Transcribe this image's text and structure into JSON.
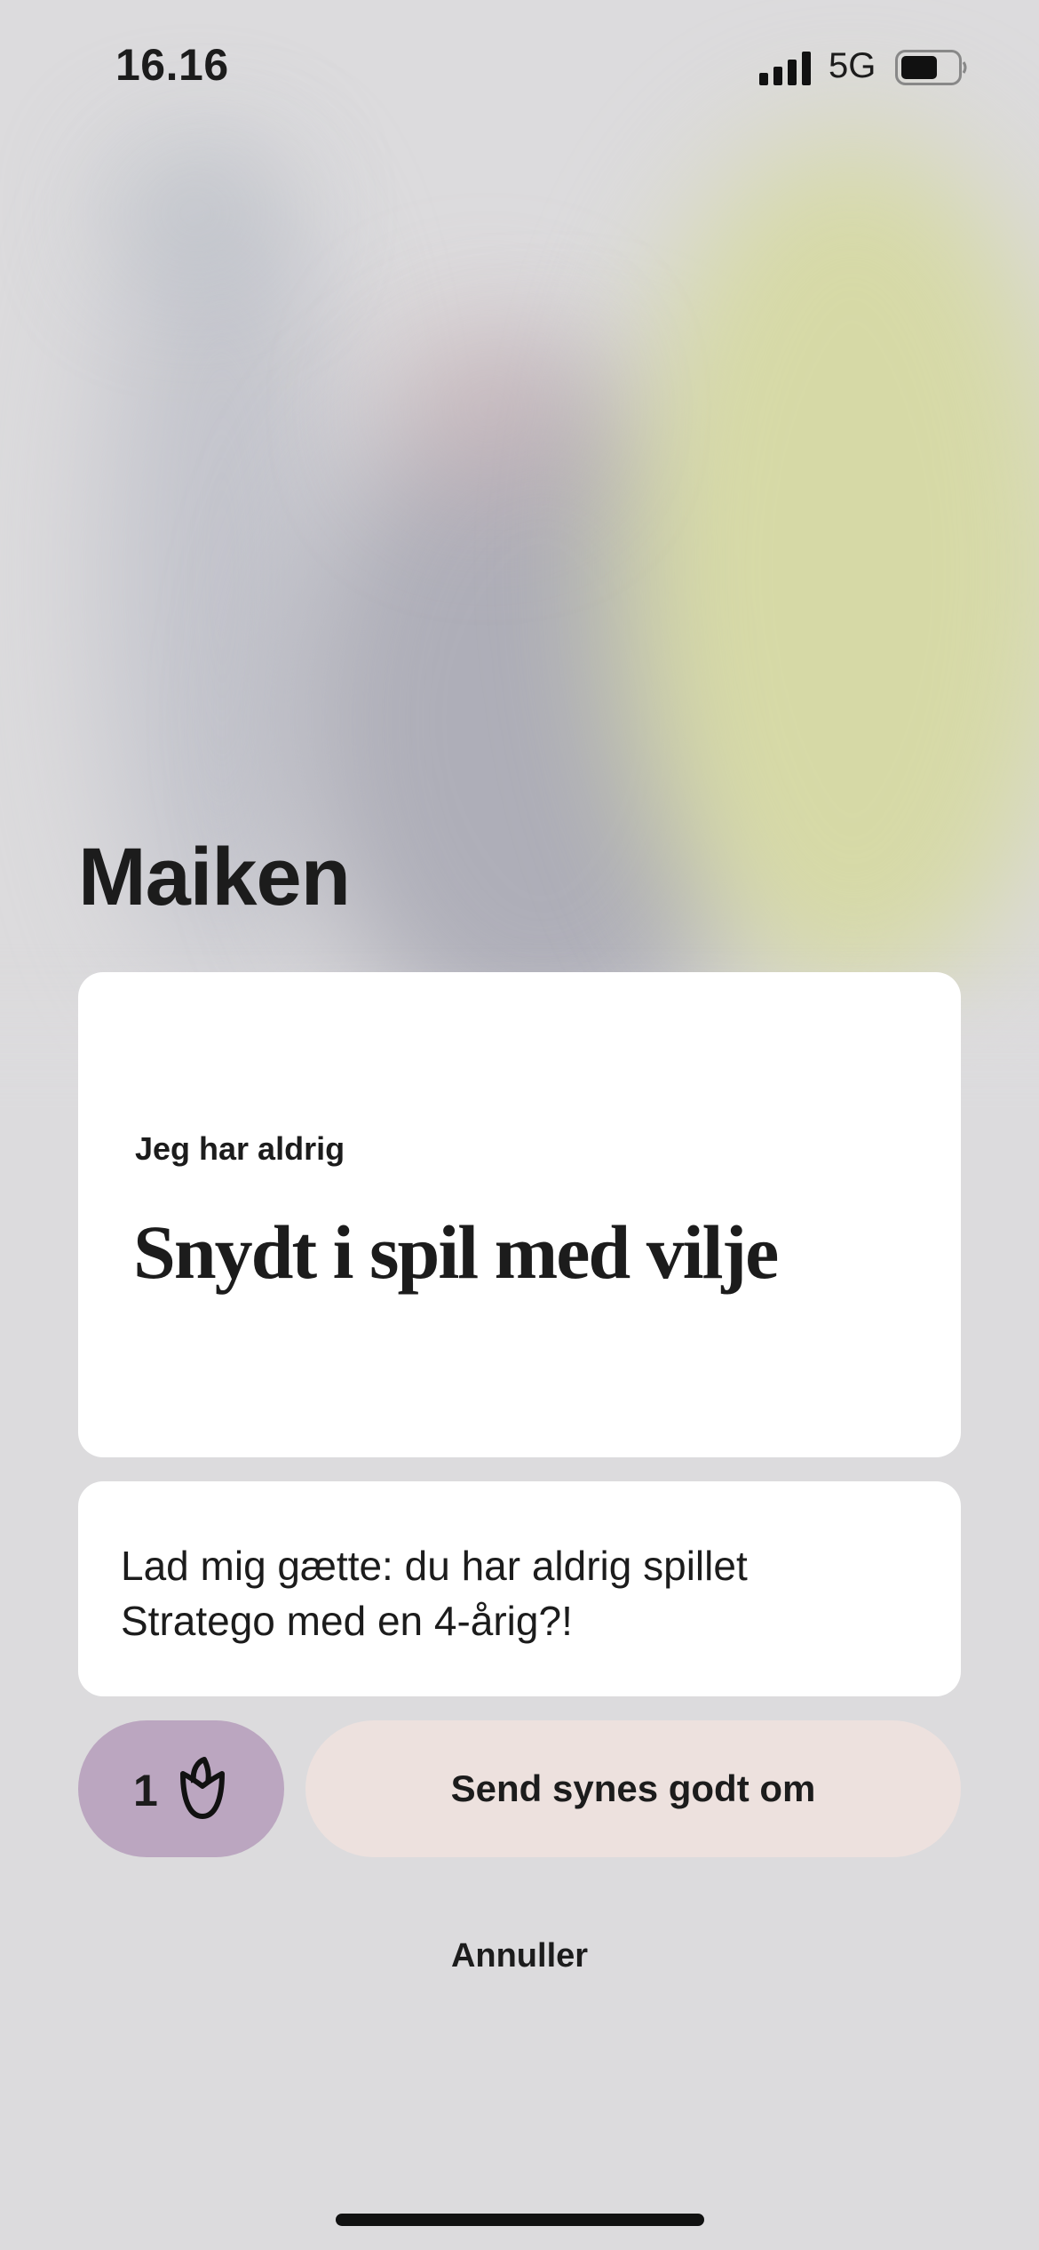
{
  "status_bar": {
    "time": "16.16",
    "network": "5G",
    "signal_icon": "cellular-signal-icon",
    "battery_icon": "battery-icon"
  },
  "profile": {
    "name": "Maiken"
  },
  "prompt": {
    "label": "Jeg har aldrig",
    "answer": "Snydt i spil med vilje"
  },
  "comment": {
    "text": "Lad mig gætte: du har aldrig spillet Stratego med en 4-årig?!"
  },
  "actions": {
    "rose_count": "1",
    "rose_icon": "rose-icon",
    "send_label": "Send synes godt om",
    "cancel_label": "Annuller"
  },
  "colors": {
    "rose_button": "#bba6c0",
    "send_button": "#ede1de",
    "card": "#ffffff"
  }
}
